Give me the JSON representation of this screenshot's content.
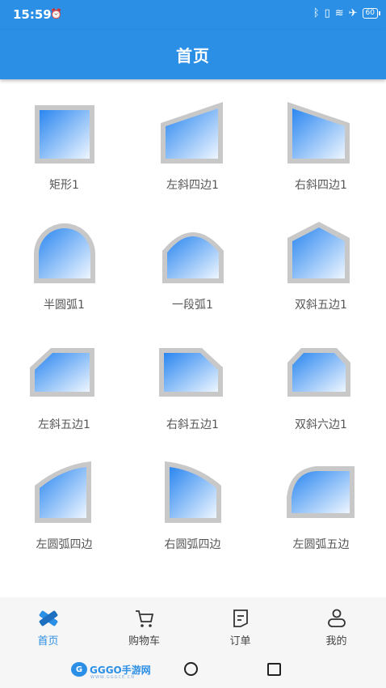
{
  "status_bar": {
    "time": "15:59",
    "alarm_icon": "alarm-off-icon",
    "icons": [
      "bluetooth-icon",
      "vibrate-icon",
      "wifi-icon",
      "airplane-icon"
    ],
    "battery": "60"
  },
  "header": {
    "title": "首页"
  },
  "shapes": [
    {
      "label": "矩形1",
      "icon": "rectangle-shape-icon"
    },
    {
      "label": "左斜四边1",
      "icon": "left-slant-quad-icon"
    },
    {
      "label": "右斜四边1",
      "icon": "right-slant-quad-icon"
    },
    {
      "label": "半圆弧1",
      "icon": "semicircle-arch-icon"
    },
    {
      "label": "一段弧1",
      "icon": "segment-arch-icon"
    },
    {
      "label": "双斜五边1",
      "icon": "double-slant-pentagon-icon"
    },
    {
      "label": "左斜五边1",
      "icon": "left-slant-pentagon-icon"
    },
    {
      "label": "右斜五边1",
      "icon": "right-slant-pentagon-icon"
    },
    {
      "label": "双斜六边1",
      "icon": "double-slant-hexagon-icon"
    },
    {
      "label": "左圆弧四边",
      "icon": "left-arc-quad-icon"
    },
    {
      "label": "右圆弧四边",
      "icon": "right-arc-quad-icon"
    },
    {
      "label": "左圆弧五边",
      "icon": "left-arc-pentagon-icon"
    }
  ],
  "bottom_nav": [
    {
      "label": "首页",
      "icon": "home-ruler-icon",
      "active": true
    },
    {
      "label": "购物车",
      "icon": "cart-icon",
      "active": false
    },
    {
      "label": "订单",
      "icon": "order-icon",
      "active": false
    },
    {
      "label": "我的",
      "icon": "profile-icon",
      "active": false
    }
  ],
  "watermark": {
    "logo": "G",
    "text": "GGGO手游网",
    "sub": "WWW.GGGCE.CN"
  },
  "colors": {
    "primary": "#2b8fe6",
    "shape_frame": "#c8c8c8",
    "shape_fill_top": "#2a86f0",
    "shape_fill_bottom": "#eef6ff"
  }
}
